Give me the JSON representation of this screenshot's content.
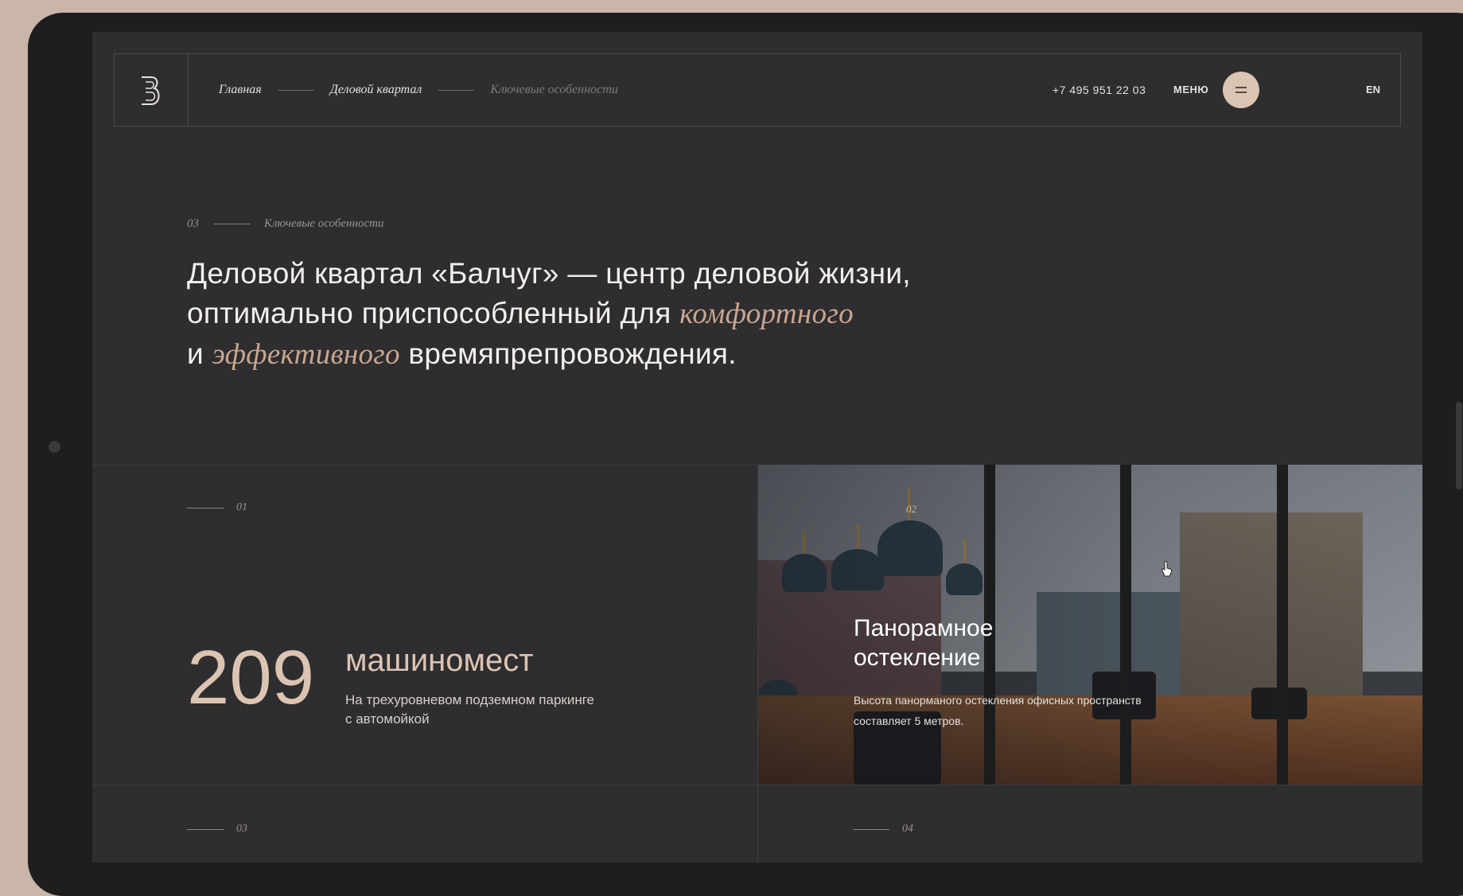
{
  "breadcrumb": [
    "Главная",
    "Деловой квартал",
    "Ключевые особенности"
  ],
  "header": {
    "phone": "+7 495 951 22 03",
    "menu_label": "МЕНЮ",
    "lang": "EN"
  },
  "intro": {
    "section_number": "03",
    "section_title": "Ключевые особенности",
    "headline_part1": "Деловой квартал «Балчуг» — центр деловой жизни,",
    "headline_part2": "оптимально приспособленный для ",
    "headline_accent1": "комфортного",
    "headline_part3": "и ",
    "headline_accent2": "эффективного",
    "headline_part4": " времяпрепровождения."
  },
  "features": [
    {
      "number": "01",
      "value": "209",
      "unit": "машиномест",
      "description": "На трехуровневом подземном паркинге с автомойкой"
    },
    {
      "number": "02",
      "title": "Панорамное остекление",
      "description": "Высота панорманого остекления офисных пространств составляет 5 метров."
    },
    {
      "number": "03"
    },
    {
      "number": "04"
    }
  ],
  "colors": {
    "background": "#2e2d2f",
    "accent": "#c9a690",
    "menu_button": "#dcc4b3",
    "frame": "#c9b5a9"
  },
  "icons": {
    "logo": "logo-b-icon",
    "menu": "menu-icon",
    "cursor": "cursor-hand-icon"
  }
}
